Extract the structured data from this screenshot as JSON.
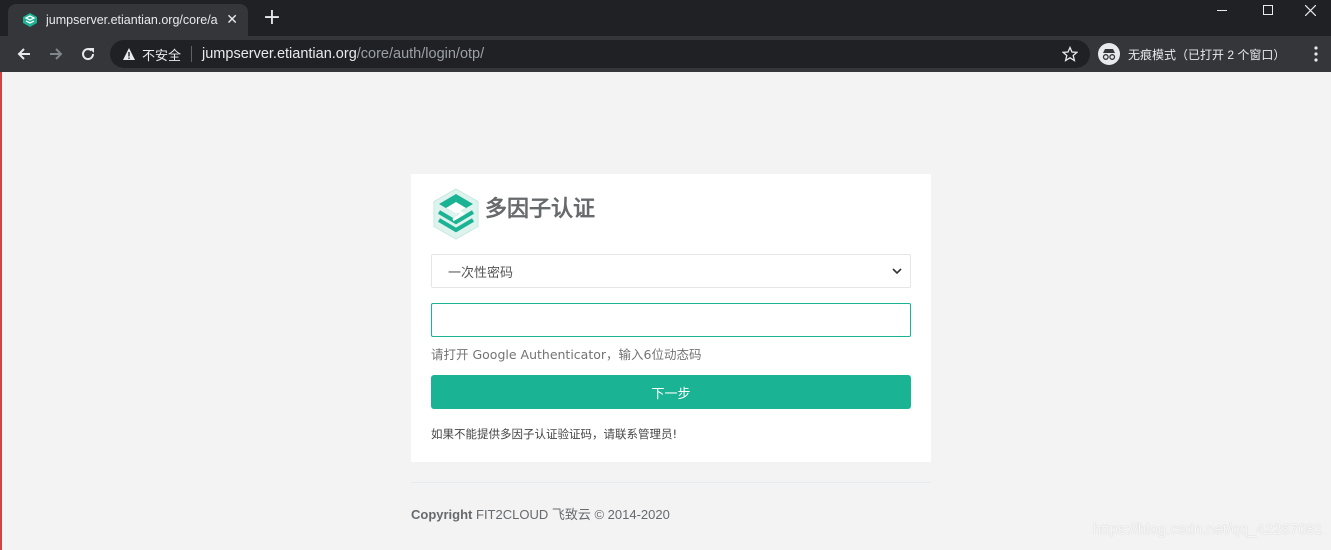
{
  "browser": {
    "tab_title": "jumpserver.etiantian.org/core/auth/login/otp/",
    "tab_close": "✕",
    "new_tab": "+",
    "insecure_label": "不安全",
    "url_host": "jumpserver.etiantian.org",
    "url_path": "/core/auth/login/otp/",
    "incognito_label": "无痕模式（已打开 2 个窗口）"
  },
  "card": {
    "title": "多因子认证",
    "method_select": {
      "selected": "一次性密码"
    },
    "code_input": {
      "value": "",
      "placeholder": ""
    },
    "help_text": "请打开 Google Authenticator，输入6位动态码",
    "next_button": "下一步",
    "contact_text": "如果不能提供多因子认证验证码，请联系管理员!"
  },
  "footer": {
    "copyright_label": "Copyright",
    "copyright_text": " FIT2CLOUD 飞致云 © 2014-2020"
  },
  "watermark": "https://blog.csdn.net/qq_42267081",
  "colors": {
    "accent": "#1ab394",
    "page_bg": "#f3f3f4",
    "chrome_dark": "#202124",
    "chrome_toolbar": "#35363a"
  }
}
